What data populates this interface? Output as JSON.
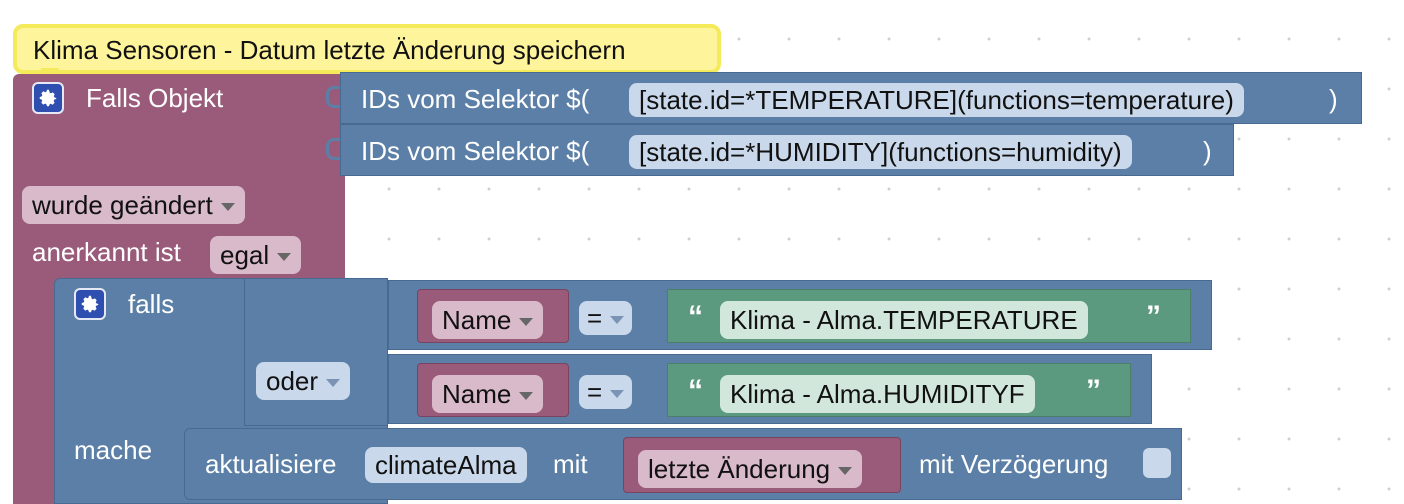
{
  "comment": {
    "text": "Klima Sensoren - Datum letzte Änderung speichern"
  },
  "trigger": {
    "label": "Falls Objekt",
    "icon": "gear-icon",
    "selectors": [
      {
        "prefix": "IDs vom Selektor $(",
        "value": "[state.id=*TEMPERATURE](functions=temperature)",
        "suffix": ")"
      },
      {
        "prefix": "IDs vom Selektor $(",
        "value": "[state.id=*HUMIDITY](functions=humidity)",
        "suffix": ")"
      }
    ],
    "change_mode": "wurde geändert",
    "ack_label": "anerkannt ist",
    "ack_value": "egal"
  },
  "if_block": {
    "label": "falls",
    "icon": "gear-icon",
    "operator": "oder",
    "conditions": [
      {
        "left": "Name",
        "op": "=",
        "quote_open": "“",
        "value": "Klima - Alma.TEMPERATURE",
        "quote_close": "”"
      },
      {
        "left": "Name",
        "op": "=",
        "quote_open": "“",
        "value": "Klima - Alma.HUMIDITYF",
        "quote_close": "”"
      }
    ],
    "do_label": "mache"
  },
  "update": {
    "label": "aktualisiere",
    "variable": "climateAlma",
    "with_label": "mit",
    "value": "letzte Änderung",
    "delay_label": "mit Verzögerung",
    "delay_checked": false
  },
  "colors": {
    "event_block": "#9a5b7a",
    "logic_block": "#5b7fa6",
    "text_block": "#5b9a7e",
    "comment_bg": "#fef49c"
  }
}
